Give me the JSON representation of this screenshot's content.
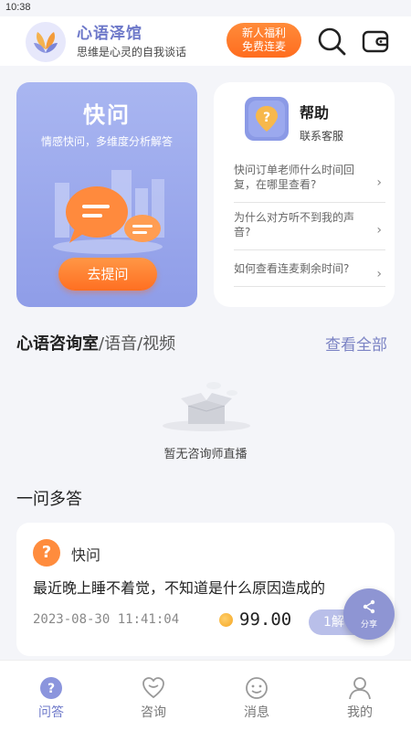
{
  "status_bar": {
    "time": "10:38"
  },
  "header": {
    "app_name": "心语泽馆",
    "tagline": "思维是心灵的自我谈话",
    "promo": {
      "line1": "新人福利",
      "line2": "免费连麦"
    }
  },
  "quick_ask": {
    "title": "快问",
    "subtitle": "情感快问，多维度分析解答",
    "button": "去提问"
  },
  "help": {
    "title": "帮助",
    "subtitle": "联系客服",
    "faqs": [
      {
        "q": "快问订单老师什么时间回复，在哪里查看?"
      },
      {
        "q": "为什么对方听不到我的声音?"
      },
      {
        "q": "如何查看连麦剩余时间?"
      }
    ]
  },
  "consult_section": {
    "title_main": "心语咨询室",
    "title_rest": "/语音/视频",
    "view_all": "查看全部",
    "empty_text": "暂无咨询师直播"
  },
  "qa_section": {
    "title": "一问多答",
    "item": {
      "badge": "?",
      "type": "快问",
      "question": "最近晚上睡不着觉，不知道是什么原因造成的",
      "time": "2023-08-30 11:41:04",
      "price": "99.00",
      "action": "1解"
    }
  },
  "share": {
    "label": "分享"
  },
  "tabs": [
    {
      "label": "问答"
    },
    {
      "label": "咨询"
    },
    {
      "label": "消息"
    },
    {
      "label": "我的"
    }
  ],
  "colors": {
    "accent": "#6d78c9",
    "orange": "#ff7a2a",
    "card_purple": "#9aa8ec"
  }
}
